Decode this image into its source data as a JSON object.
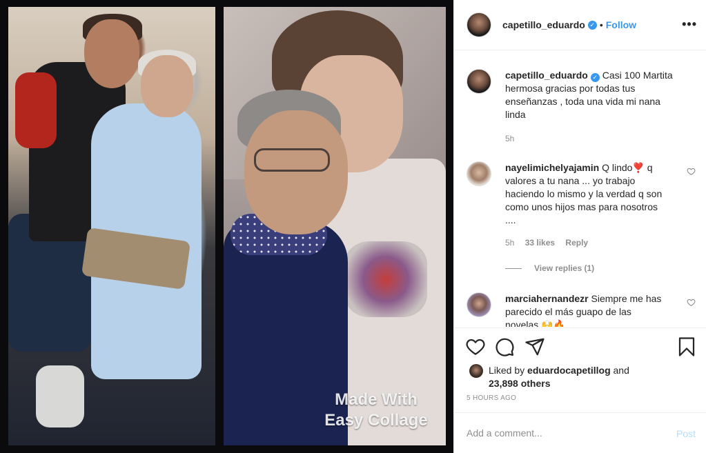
{
  "media": {
    "watermark_line1": "Made With",
    "watermark_line2": "Easy Collage"
  },
  "header": {
    "username": "capetillo_eduardo",
    "dot": "•",
    "follow_label": "Follow",
    "more_label": "•••"
  },
  "caption": {
    "username": "capetillo_eduardo",
    "text": "Casi 100 Martita hermosa gracias por todas tus enseñanzas , toda una vida mi nana linda",
    "time": "5h"
  },
  "comments": [
    {
      "username": "nayelimichelyajamin",
      "text": "Q lindo❣️ q valores a tu nana ... yo trabajo haciendo lo mismo y la verdad q son como unos hijos mas para nosotros ....",
      "time": "5h",
      "likes": "33 likes",
      "reply_label": "Reply",
      "view_replies": "View replies (1)"
    },
    {
      "username": "marciahernandezr",
      "text": "Siempre me has parecido el más guapo de las novelas 🙌🔥"
    }
  ],
  "actions": {
    "like_icon": "heart-icon",
    "comment_icon": "comment-icon",
    "share_icon": "share-icon",
    "save_icon": "bookmark-icon"
  },
  "likes": {
    "prefix": "Liked by",
    "liker": "eduardocapetillog",
    "and": "and",
    "others": "23,898 others"
  },
  "timestamp": "5 HOURS AGO",
  "add_comment": {
    "placeholder": "Add a comment...",
    "post_label": "Post"
  },
  "colors": {
    "accent": "#3897f0",
    "muted": "#8e8e8e",
    "text": "#262626",
    "post_disabled": "#b2dffc"
  }
}
